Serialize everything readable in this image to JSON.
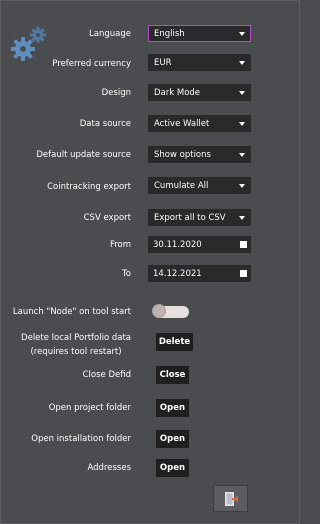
{
  "settings": {
    "language": {
      "label": "Language",
      "value": "English"
    },
    "currency": {
      "label": "Preferred currency",
      "value": "EUR"
    },
    "design": {
      "label": "Design",
      "value": "Dark Mode"
    },
    "data_source": {
      "label": "Data source",
      "value": "Active Wallet"
    },
    "update_source": {
      "label": "Default update source",
      "value": "Show options"
    },
    "cointracking": {
      "label": "Cointracking export",
      "value": "Cumulate All"
    },
    "csv_export": {
      "label": "CSV export",
      "value": "Export all to CSV"
    },
    "from": {
      "label": "From",
      "value": "30.11.2020"
    },
    "to": {
      "label": "To",
      "value": "14.12.2021"
    },
    "launch_node": {
      "label": "Launch \"Node\" on tool start",
      "enabled": false
    }
  },
  "actions": {
    "delete_portfolio": {
      "label_line1": "Delete local Portfolio data",
      "label_line2": "(requires tool restart)",
      "button": "Delete"
    },
    "close_defid": {
      "label": "Close Defid",
      "button": "Close"
    },
    "open_project": {
      "label": "Open project folder",
      "button": "Open"
    },
    "open_installation": {
      "label": "Open installation folder",
      "button": "Open"
    },
    "addresses": {
      "label": "Addresses",
      "button": "Open"
    }
  },
  "colors": {
    "background": "#4a4c50",
    "field": "#2a2a2c",
    "accent_border": "#b94ad1",
    "gear": "#5f8fbf",
    "exit_door": "#e0e4ea",
    "exit_arrow": "#e06a3a"
  },
  "icons": {
    "settings": "gear-icon",
    "exit": "exit-icon"
  }
}
